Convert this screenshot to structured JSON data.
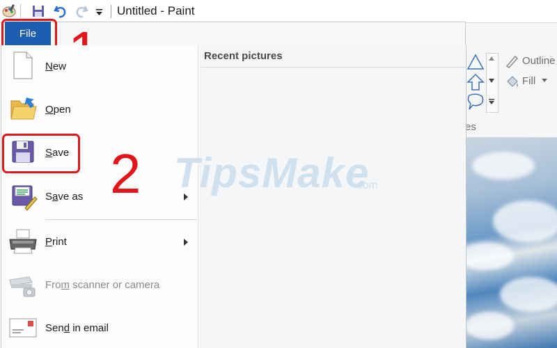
{
  "window": {
    "title": "Untitled - Paint"
  },
  "file_button": {
    "label": "File"
  },
  "annotations": {
    "step1": "1",
    "step2": "2"
  },
  "recent": {
    "title": "Recent pictures"
  },
  "menu_items": [
    {
      "label": "New",
      "accel": "N"
    },
    {
      "label": "Open",
      "accel": "O"
    },
    {
      "label": "Save",
      "accel": "S"
    },
    {
      "label": "Save as",
      "accel": "a"
    },
    {
      "label": "Print",
      "accel": "P"
    },
    {
      "label": "From scanner or camera",
      "accel": "m"
    },
    {
      "label": "Send in email",
      "accel": "d"
    }
  ],
  "ribbon": {
    "outline_label": "Outline",
    "fill_label": "Fill",
    "shapes_partial": "es"
  },
  "watermark": {
    "text": "TipsMake",
    "suffix": ".com"
  },
  "colors": {
    "accent": "#1c5fb1",
    "annotation": "#e0161b"
  }
}
